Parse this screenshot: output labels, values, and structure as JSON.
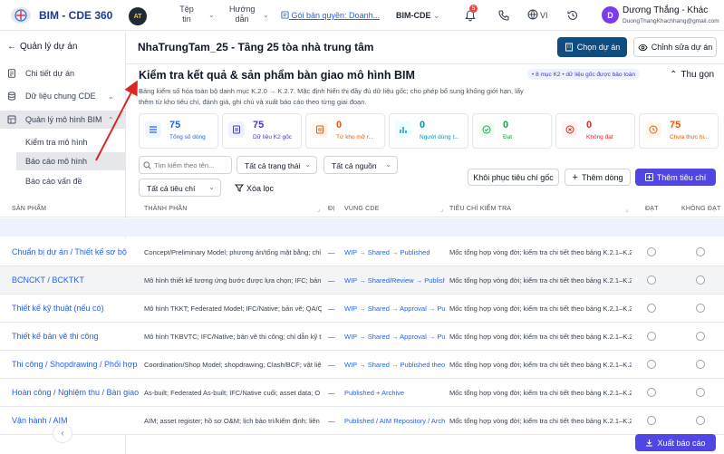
{
  "header": {
    "app_name": "BIM - CDE 360",
    "brand_badge": "AT",
    "menu_file": "Tệp tin",
    "menu_guide": "Hướng dẫn",
    "license_link": "Gói bản quyền: Doanh...",
    "product_selector": "BIM-CDE",
    "notification_count": "5",
    "language": "VI",
    "user_initial": "D",
    "user_name": "Dương Thắng - Khác",
    "user_email": "DuongThangKhachhang@gmail.com"
  },
  "sidebar": {
    "back_label": "Quản lý dự án",
    "items": [
      {
        "label": "Chi tiết dự án"
      },
      {
        "label": "Dữ liệu chung CDE"
      },
      {
        "label": "Quản lý mô hình BIM"
      }
    ],
    "subitems": [
      {
        "label": "Kiểm tra mô hình"
      },
      {
        "label": "Báo cáo mô hình"
      },
      {
        "label": "Báo cáo vấn đề"
      }
    ]
  },
  "page": {
    "project_title": "NhaTrungTam_25 - Tầng 25 tòa nhà trung tâm",
    "choose_project": "Chọn dự án",
    "edit_project": "Chỉnh sửa dự án"
  },
  "section": {
    "title": "Kiểm tra kết quả & sản phẩm bàn giao mô hình BIM",
    "badge": "• 8 mục K2 • dữ liệu gốc được bảo toàn",
    "collapse_label": "Thu gọn",
    "description": "Bảng kiểm số hóa toàn bộ danh mục K.2.0 → K.2.7. Mặc định hiển thị đầy đủ dữ liệu gốc; cho phép bổ sung khống giới hạn, lấy thêm từ kho tiêu chí, đánh giá, ghi chú và xuất báo cáo theo từng giai đoạn."
  },
  "stats": [
    {
      "value": "75",
      "label": "Tổng số dòng",
      "color": "#2563eb",
      "bg": "#eff6ff"
    },
    {
      "value": "75",
      "label": "Dữ liệu K2 gốc",
      "color": "#4338ca",
      "bg": "#eef2ff"
    },
    {
      "value": "0",
      "label": "Từ kho mở r...",
      "color": "#ea580c",
      "bg": "#fff7ed"
    },
    {
      "value": "0",
      "label": "Người dùng t...",
      "color": "#0891b2",
      "bg": "#ecfeff"
    },
    {
      "value": "0",
      "label": "Đạt",
      "color": "#16a34a",
      "bg": "#f0fdf4"
    },
    {
      "value": "0",
      "label": "Không đạt",
      "color": "#dc2626",
      "bg": "#fef2f2"
    },
    {
      "value": "75",
      "label": "Chưa thực hi...",
      "color": "#ea580c",
      "bg": "#fff7ed"
    }
  ],
  "filters": {
    "search_placeholder": "Tìm kiếm theo tên...",
    "status": "Tất cả trạng thái",
    "source": "Tất cả nguồn",
    "criteria": "Tất cả tiêu chí",
    "clear": "Xóa lọc",
    "restore": "Khôi phục tiêu chí gốc",
    "add_row": "Thêm dòng",
    "add_criteria": "Thêm tiêu chí"
  },
  "table": {
    "headers": {
      "product": "SẢN PHẨM",
      "component": "THÀNH PHẦN",
      "dk": "ĐỊ",
      "zone": "VÙNG CDE",
      "criteria": "TIÊU CHÍ KIỂM TRA",
      "pass": "ĐẠT",
      "fail": "KHÔNG ĐẠT"
    },
    "rows": [
      {
        "product": "Chuẩn bị dự án / Thiết kế sơ bộ",
        "component": "Concept/Preliminary Model; phương án/tổng mặt bằng; chỉ",
        "dash": "—",
        "zone": "WIP → Shared → Published",
        "criteria": "Mốc tổng hợp vòng đời; kiểm tra chi tiết theo bảng K.2.1–K.2"
      },
      {
        "product": "BCNCKT / BCKTKT",
        "component": "Mô hình thiết kế tương ứng bước được lựa chọn; IFC; bản v",
        "dash": "—",
        "zone": "WIP → Shared/Review → Published",
        "criteria": "Mốc tổng hợp vòng đời; kiểm tra chi tiết theo bảng K.2.1–K.2"
      },
      {
        "product": "Thiết kế kỹ thuật (nếu có)",
        "component": "Mô hình TKKT; Federated Model; IFC/Native; bản vẽ; QA/Q",
        "dash": "—",
        "zone": "WIP → Shared → Approval → Published",
        "criteria": "Mốc tổng hợp vòng đời; kiểm tra chi tiết theo bảng K.2.1–K.2"
      },
      {
        "product": "Thiết kế bản vẽ thi công",
        "component": "Mô hình TKBVTC; IFC/Native; bản vẽ thi công; chỉ dẫn kỹ thuật",
        "dash": "—",
        "zone": "WIP → Shared → Approval → Published",
        "criteria": "Mốc tổng hợp vòng đời; kiểm tra chi tiết theo bảng K.2.1–K.2"
      },
      {
        "product": "Thi công / Shopdrawing / Phối hợp",
        "component": "Coordination/Shop Model; shopdrawing; Clash/BCF; vật liệu",
        "dash": "—",
        "zone": "WIP → Shared → Published theo",
        "criteria": "Mốc tổng hợp vòng đời; kiểm tra chi tiết theo bảng K.2.1–K.2"
      },
      {
        "product": "Hoàn công / Nghiệm thu / Bàn giao",
        "component": "As-built; Federated As-built; IFC/Native cuối; asset data; O",
        "dash": "—",
        "zone": "Published + Archive",
        "criteria": "Mốc tổng hợp vòng đời; kiểm tra chi tiết theo bảng K.2.1–K.2"
      },
      {
        "product": "Vận hành / AIM",
        "component": "AIM; asset register; hồ sơ O&M; lịch bảo trì/kiểm định; liên kết",
        "dash": "—",
        "zone": "Published / AIM Repository / Archive",
        "criteria": "Mốc tổng hợp vòng đời; kiểm tra chi tiết theo bảng K.2.1–K.2"
      }
    ]
  },
  "footer": {
    "export": "Xuất báo cáo"
  },
  "colors": {
    "primary": "#0f4c81",
    "accent": "#4f46e5",
    "annotation_arrow": "#dc2626"
  }
}
